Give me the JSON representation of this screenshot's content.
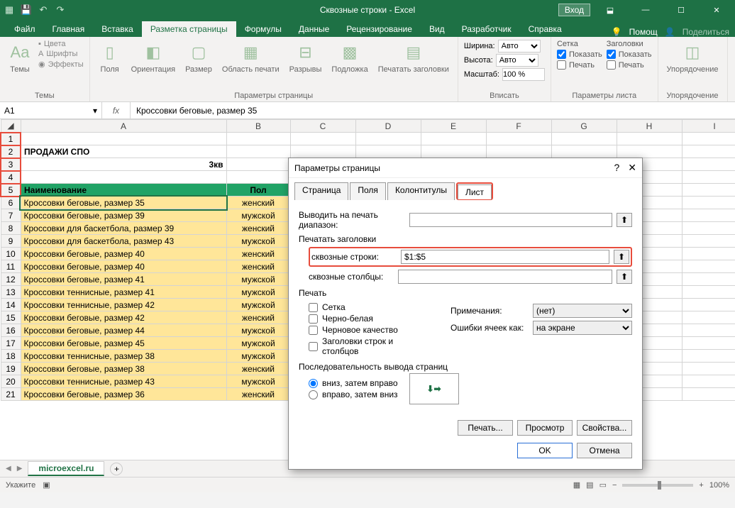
{
  "titlebar": {
    "title": "Сквозные строки  -  Excel",
    "login": "Вход"
  },
  "tabs": {
    "file": "Файл",
    "home": "Главная",
    "insert": "Вставка",
    "layout": "Разметка страницы",
    "formulas": "Формулы",
    "data": "Данные",
    "review": "Рецензирование",
    "view": "Вид",
    "dev": "Разработчик",
    "help": "Справка",
    "tellme": "Помощ",
    "share": "Поделиться"
  },
  "ribbon": {
    "themes": {
      "label": "Темы",
      "btn": "Темы",
      "colors": "Цвета",
      "fonts": "Шрифты",
      "effects": "Эффекты"
    },
    "pagesetup": {
      "label": "Параметры страницы",
      "margins": "Поля",
      "orient": "Ориентация",
      "size": "Размер",
      "area": "Область печати",
      "breaks": "Разрывы",
      "bg": "Подложка",
      "titles": "Печатать заголовки"
    },
    "scale": {
      "label": "Вписать",
      "width": "Ширина:",
      "height": "Высота:",
      "auto": "Авто",
      "scale_lbl": "Масштаб:",
      "scale_val": "100 %"
    },
    "sheetopts": {
      "label": "Параметры листа",
      "grid": "Сетка",
      "hdrs": "Заголовки",
      "show": "Показать",
      "print": "Печать"
    },
    "arrange": {
      "label": "Упорядочение",
      "btn": "Упорядочение"
    }
  },
  "namebox": "A1",
  "formula": "Кроссовки беговые, размер 35",
  "columns": [
    "A",
    "B",
    "C",
    "D",
    "E",
    "F",
    "G",
    "H",
    "I"
  ],
  "rows": [
    {
      "n": 1,
      "a": "",
      "b": ""
    },
    {
      "n": 2,
      "a": "ПРОДАЖИ СПО",
      "b": "",
      "bold": true
    },
    {
      "n": 3,
      "a": "3кв",
      "b": "",
      "bold": true,
      "right": true
    },
    {
      "n": 4,
      "a": "",
      "b": ""
    },
    {
      "n": 5,
      "a": "Наименование",
      "b": "Пол",
      "green": true
    },
    {
      "n": 6,
      "a": "Кроссовки беговые, размер 35",
      "b": "женский",
      "y": true,
      "active": true
    },
    {
      "n": 7,
      "a": "Кроссовки беговые, размер 39",
      "b": "мужской",
      "y": true
    },
    {
      "n": 8,
      "a": "Кроссовки для баскетбола, размер 39",
      "b": "женский",
      "y": true
    },
    {
      "n": 9,
      "a": "Кроссовки для баскетбола, размер 43",
      "b": "мужской",
      "y": true
    },
    {
      "n": 10,
      "a": "Кроссовки беговые, размер 40",
      "b": "женский",
      "y": true
    },
    {
      "n": 11,
      "a": "Кроссовки беговые, размер 40",
      "b": "женский",
      "y": true
    },
    {
      "n": 12,
      "a": "Кроссовки беговые, размер 41",
      "b": "мужской",
      "y": true
    },
    {
      "n": 13,
      "a": "Кроссовки теннисные, размер 41",
      "b": "мужской",
      "y": true
    },
    {
      "n": 14,
      "a": "Кроссовки теннисные, размер 42",
      "b": "мужской",
      "y": true
    },
    {
      "n": 15,
      "a": "Кроссовки беговые, размер 42",
      "b": "женский",
      "y": true
    },
    {
      "n": 16,
      "a": "Кроссовки беговые, размер 44",
      "b": "мужской",
      "y": true
    },
    {
      "n": 17,
      "a": "Кроссовки беговые, размер 45",
      "b": "мужской",
      "y": true
    },
    {
      "n": 18,
      "a": "Кроссовки теннисные, размер 38",
      "b": "мужской",
      "y": true
    },
    {
      "n": 19,
      "a": "Кроссовки беговые, размер 38",
      "b": "женский",
      "y": true
    },
    {
      "n": 20,
      "a": "Кроссовки теннисные, размер 43",
      "b": "мужской",
      "y": true
    },
    {
      "n": 21,
      "a": "Кроссовки беговые, размер 36",
      "b": "женский",
      "y": true
    }
  ],
  "dialog": {
    "title": "Параметры страницы",
    "tabs": {
      "page": "Страница",
      "margins": "Поля",
      "hf": "Колонтитулы",
      "sheet": "Лист"
    },
    "print_area": "Выводить на печать диапазон:",
    "print_titles": "Печатать заголовки",
    "rows_lbl": "сквозные строки:",
    "rows_val": "$1:$5",
    "cols_lbl": "сквозные столбцы:",
    "cols_val": "",
    "print_hdr": "Печать",
    "grid": "Сетка",
    "bw": "Черно-белая",
    "draft": "Черновое качество",
    "rchdrs": "Заголовки строк и столбцов",
    "comments": "Примечания:",
    "comments_val": "(нет)",
    "errors": "Ошибки ячеек как:",
    "errors_val": "на экране",
    "order_hdr": "Последовательность вывода страниц",
    "down": "вниз, затем вправо",
    "over": "вправо, затем вниз",
    "print_btn": "Печать...",
    "preview": "Просмотр",
    "props": "Свойства...",
    "ok": "OK",
    "cancel": "Отмена"
  },
  "sheettab": "microexcel.ru",
  "status": {
    "ready": "Укажите",
    "zoom": "100%"
  }
}
